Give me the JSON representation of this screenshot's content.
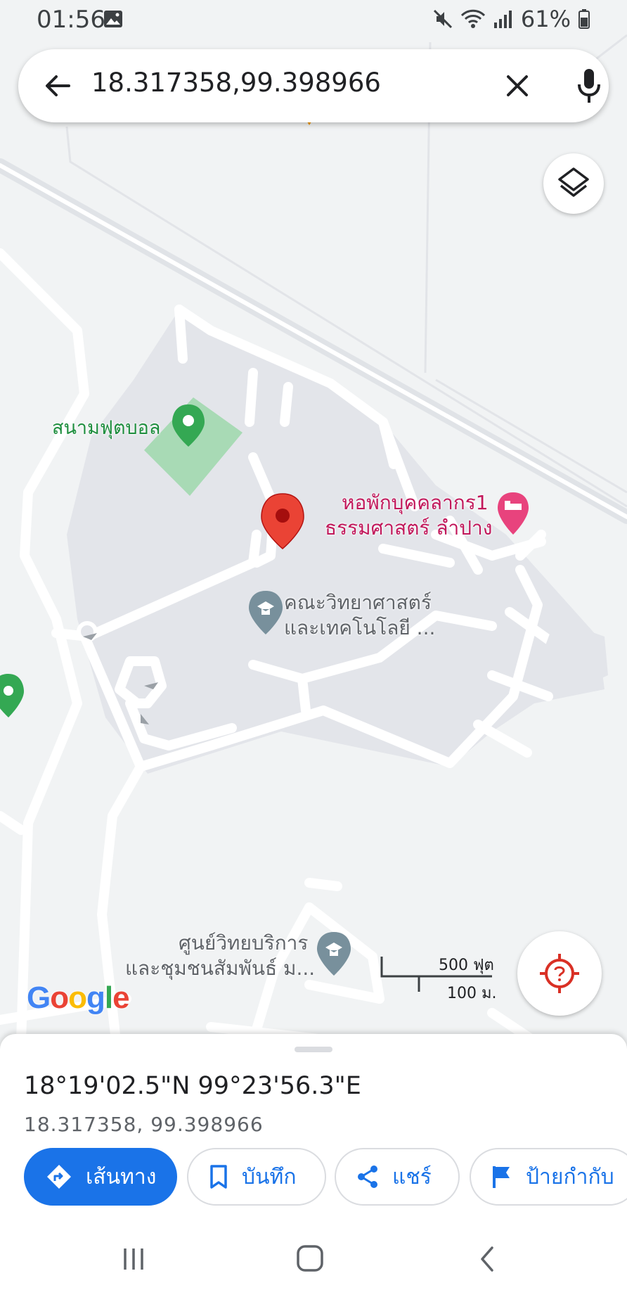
{
  "status_bar": {
    "time": "01:56",
    "battery": "61%"
  },
  "search": {
    "query": "18.317358,99.398966"
  },
  "map": {
    "labels": {
      "football_field": "สนามฟุตบอล",
      "dorm_line1": "หอพักบุคคลากร1",
      "dorm_line2": "ธรรมศาสตร์ ลำปาง",
      "faculty_line1": "คณะวิทยาศาสตร์",
      "faculty_line2": "และเทคโนโลยี ...",
      "center_line1": "ศูนย์วิทยบริการ",
      "center_line2": "และชุมชนสัมพันธ์ ม..."
    },
    "scale": {
      "feet": "500 ฟุต",
      "meters": "100 ม."
    },
    "logo": {
      "letters": [
        "G",
        "o",
        "o",
        "g",
        "l",
        "e"
      ]
    },
    "colors": {
      "pin": "#ea4335",
      "park": "#34a853",
      "lodging": "#e8437d",
      "poi_gray": "#78909c",
      "campus_fill": "#e3e5ea",
      "road": "#ffffff",
      "background": "#f1f3f4"
    }
  },
  "place_sheet": {
    "coordinates_dms": "18°19'02.5\"N 99°23'56.3\"E",
    "coordinates_decimal": "18.317358, 99.398966",
    "actions": {
      "directions": "เส้นทาง",
      "save": "บันทึก",
      "share": "แชร์",
      "label": "ป้ายกำกับ"
    }
  },
  "icons": [
    "back-arrow-icon",
    "clear-icon",
    "mic-icon",
    "layers-icon",
    "my-location-icon",
    "directions-icon",
    "bookmark-icon",
    "share-icon",
    "flag-icon",
    "recents-icon",
    "home-icon",
    "back-nav-icon",
    "graduation-cap-icon",
    "bed-icon",
    "tree-icon",
    "location-pin-icon"
  ]
}
